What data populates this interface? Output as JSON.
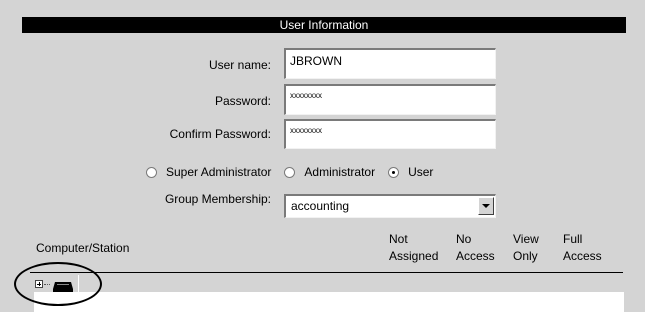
{
  "header": {
    "title": "User Information"
  },
  "form": {
    "username": {
      "label": "User name:",
      "value": "JBROWN"
    },
    "password": {
      "label": "Password:",
      "value": "xxxxxxxx"
    },
    "confirm_password": {
      "label": "Confirm Password:",
      "value": "xxxxxxxx"
    },
    "roles": [
      {
        "label": "Super Administrator",
        "checked": false
      },
      {
        "label": "Administrator",
        "checked": false
      },
      {
        "label": "User",
        "checked": true
      }
    ],
    "group_membership": {
      "label": "Group Membership:",
      "value": "accounting"
    }
  },
  "access_table": {
    "first_column": "Computer/Station",
    "columns": [
      {
        "line1": "Not",
        "line2": "Assigned"
      },
      {
        "line1": "No",
        "line2": "Access"
      },
      {
        "line1": "View",
        "line2": "Only"
      },
      {
        "line1": "Full",
        "line2": "Access"
      }
    ]
  },
  "icons": {
    "expander": "plus-expander-icon",
    "computer": "computer-station-icon"
  }
}
